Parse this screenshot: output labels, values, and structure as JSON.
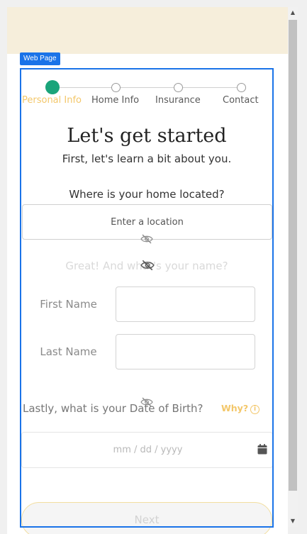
{
  "stepper": {
    "steps": [
      {
        "label": "Personal Info",
        "state": "active"
      },
      {
        "label": "Home Info",
        "state": "upcoming"
      },
      {
        "label": "Insurance",
        "state": "upcoming"
      },
      {
        "label": "Contact",
        "state": "upcoming"
      }
    ]
  },
  "page_tag": "Web Page",
  "header": {
    "title": "Let's get started",
    "subtitle": "First, let's learn a bit about you."
  },
  "location": {
    "question": "Where is your home located?",
    "placeholder": "Enter a location"
  },
  "name_section": {
    "question": "Great! And what's your name?",
    "first_name_label": "First Name",
    "last_name_label": "Last Name"
  },
  "dob": {
    "question": "Lastly, what is your Date of Birth?",
    "why_label": "Why?",
    "placeholder": "mm / dd / yyyy"
  },
  "next_label": "Next",
  "colors": {
    "accent_green": "#1aa47a",
    "accent_gold": "#f3c76a",
    "banner": "#f6eedb",
    "highlight_blue": "#1a73e8"
  },
  "icons": [
    "eye-slash-icon",
    "info-circle-icon",
    "calendar-icon",
    "scroll-up-arrow-icon",
    "scroll-down-arrow-icon"
  ]
}
